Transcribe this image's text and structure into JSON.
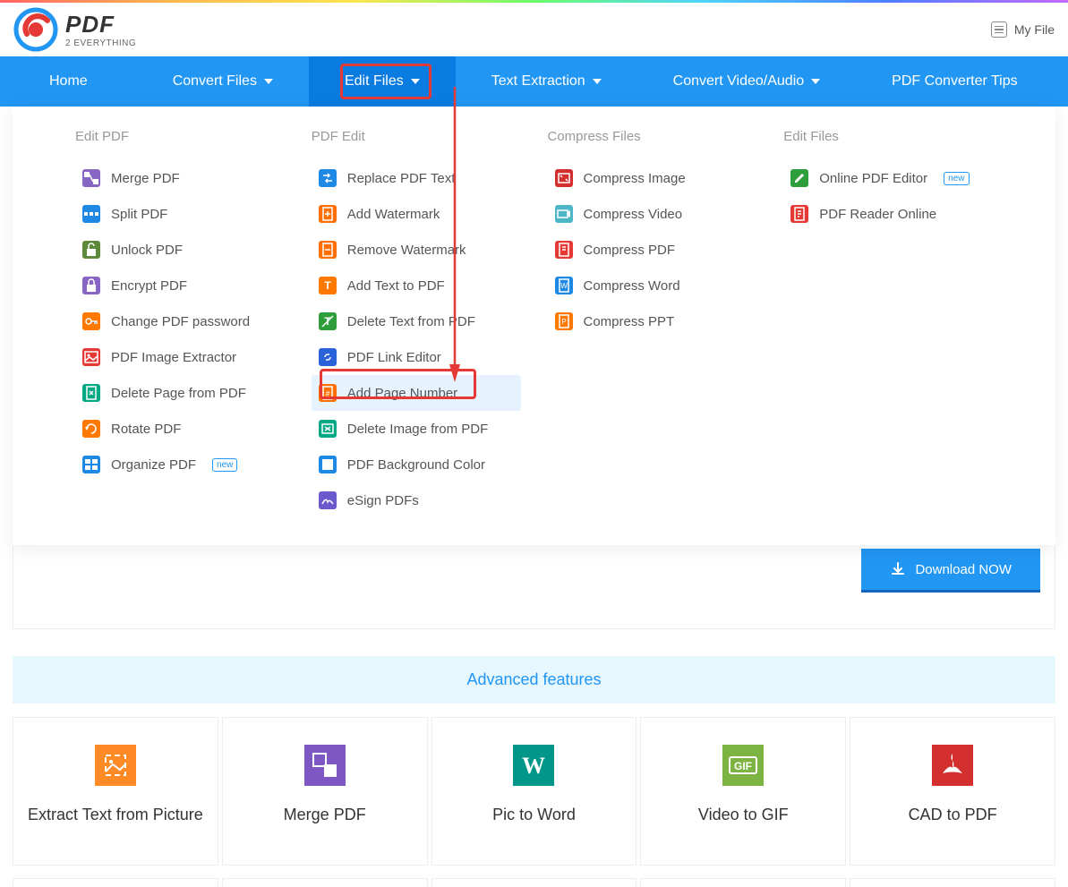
{
  "header": {
    "logo_main": "PDF",
    "logo_sub": "2 EVERYTHING",
    "myfile": "My File"
  },
  "nav": {
    "home": "Home",
    "convert_files": "Convert Files",
    "edit_files": "Edit Files",
    "text_extraction": "Text Extraction",
    "convert_video": "Convert Video/Audio",
    "tips": "PDF Converter Tips"
  },
  "dropdown": {
    "col1": {
      "title": "Edit PDF",
      "items": [
        {
          "label": "Merge PDF",
          "icon": "merge",
          "bg": "ic-bg-purple"
        },
        {
          "label": "Split PDF",
          "icon": "split",
          "bg": "ic-bg-blue"
        },
        {
          "label": "Unlock PDF",
          "icon": "unlock",
          "bg": "ic-bg-olive"
        },
        {
          "label": "Encrypt PDF",
          "icon": "lock",
          "bg": "ic-bg-purple"
        },
        {
          "label": "Change PDF password",
          "icon": "key",
          "bg": "ic-bg-orange"
        },
        {
          "label": "PDF Image Extractor",
          "icon": "image",
          "bg": "ic-bg-red"
        },
        {
          "label": "Delete Page from PDF",
          "icon": "delete-page",
          "bg": "ic-bg-teal"
        },
        {
          "label": "Rotate PDF",
          "icon": "rotate",
          "bg": "ic-bg-orange"
        },
        {
          "label": "Organize PDF",
          "icon": "organize",
          "bg": "ic-bg-blue",
          "new": true
        }
      ]
    },
    "col2": {
      "title": "PDF Edit",
      "items": [
        {
          "label": "Replace PDF Text",
          "icon": "replace",
          "bg": "ic-bg-blue"
        },
        {
          "label": "Add Watermark",
          "icon": "watermark",
          "bg": "ic-bg-darkorange"
        },
        {
          "label": "Remove Watermark",
          "icon": "remove-wm",
          "bg": "ic-bg-darkorange"
        },
        {
          "label": "Add Text to PDF",
          "icon": "add-text",
          "bg": "ic-bg-orange"
        },
        {
          "label": "Delete Text from PDF",
          "icon": "delete-text",
          "bg": "ic-bg-green"
        },
        {
          "label": "PDF Link Editor",
          "icon": "link",
          "bg": "ic-bg-darkblue"
        },
        {
          "label": "Add Page Number",
          "icon": "page-num",
          "bg": "ic-bg-darkorange",
          "highlighted": true
        },
        {
          "label": "Delete Image from PDF",
          "icon": "delete-img",
          "bg": "ic-bg-teal"
        },
        {
          "label": "PDF Background Color",
          "icon": "bgcolor",
          "bg": "ic-bg-blue"
        },
        {
          "label": "eSign PDFs",
          "icon": "esign",
          "bg": "ic-bg-purple2"
        }
      ]
    },
    "col3": {
      "title": "Compress Files",
      "items": [
        {
          "label": "Compress Image",
          "icon": "comp-img",
          "bg": "ic-bg-crimson"
        },
        {
          "label": "Compress Video",
          "icon": "comp-vid",
          "bg": "ic-bg-cyan"
        },
        {
          "label": "Compress PDF",
          "icon": "comp-pdf",
          "bg": "ic-bg-red"
        },
        {
          "label": "Compress Word",
          "icon": "comp-word",
          "bg": "ic-bg-blue"
        },
        {
          "label": "Compress PPT",
          "icon": "comp-ppt",
          "bg": "ic-bg-orange"
        }
      ]
    },
    "col4": {
      "title": "Edit Files",
      "items": [
        {
          "label": "Online PDF Editor",
          "icon": "editor",
          "bg": "ic-bg-green",
          "new": true
        },
        {
          "label": "PDF Reader Online",
          "icon": "reader",
          "bg": "ic-bg-red"
        }
      ]
    }
  },
  "download_label": "Download NOW",
  "adv_features": "Advanced features",
  "badge_new": "new",
  "cards": [
    {
      "label": "Extract Text from Picture",
      "icon": "extract",
      "bg": "#ff8a26"
    },
    {
      "label": "Merge PDF",
      "icon": "merge",
      "bg": "#7e57c2"
    },
    {
      "label": "Pic to Word",
      "icon": "W",
      "bg": "#009688"
    },
    {
      "label": "Video to GIF",
      "icon": "GIF",
      "bg": "#7cb342"
    },
    {
      "label": "CAD to PDF",
      "icon": "pdf",
      "bg": "#d32f2f"
    }
  ]
}
